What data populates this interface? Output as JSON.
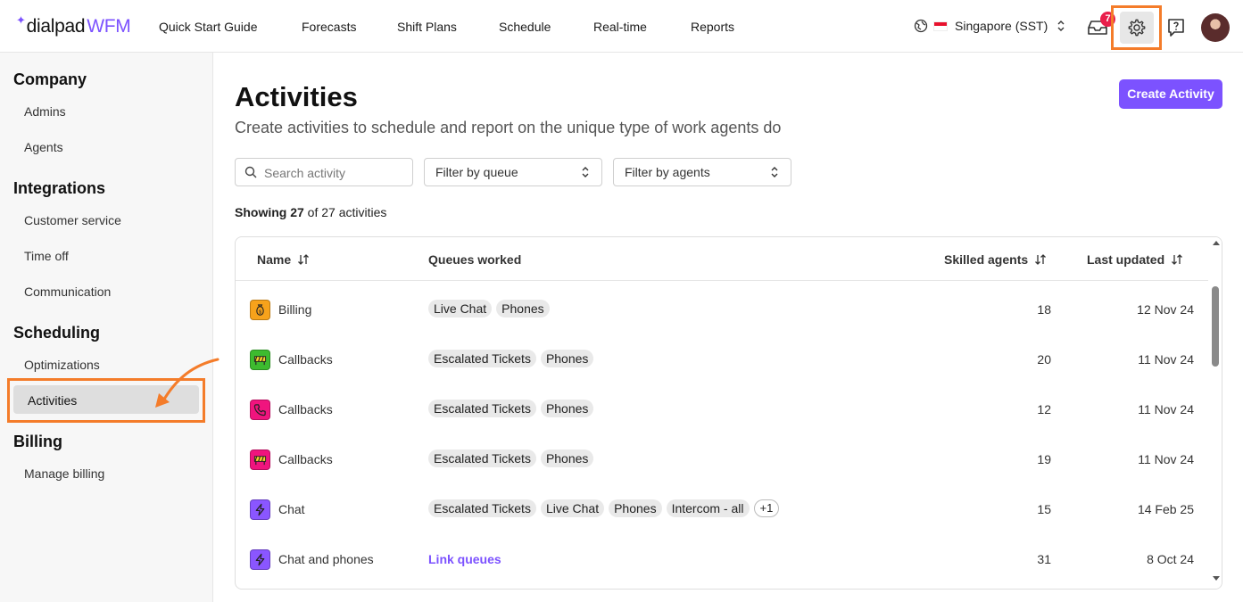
{
  "brand": {
    "part1": "dialpad",
    "part2": "WFM",
    "spark": "✦"
  },
  "nav": [
    "Quick Start Guide",
    "Forecasts",
    "Shift Plans",
    "Schedule",
    "Real-time",
    "Reports"
  ],
  "header": {
    "timezone": "Singapore (SST)",
    "inbox_badge": "7",
    "icons": [
      "globe-icon",
      "flag-icon",
      "inbox-icon",
      "gear-icon",
      "help-icon",
      "avatar"
    ]
  },
  "sidebar": {
    "sections": [
      {
        "title": "Company",
        "items": [
          "Admins",
          "Agents"
        ]
      },
      {
        "title": "Integrations",
        "items": [
          "Customer service",
          "Time off",
          "Communication"
        ]
      },
      {
        "title": "Scheduling",
        "items": [
          "Optimizations",
          "Activities"
        ]
      },
      {
        "title": "Billing",
        "items": [
          "Manage billing"
        ]
      }
    ],
    "active_item": "Activities"
  },
  "page": {
    "title": "Activities",
    "subtitle": "Create activities to schedule and report on the unique type of work agents do",
    "create_button": "Create Activity"
  },
  "filters": {
    "search_placeholder": "Search activity",
    "queue_filter": "Filter by queue",
    "agent_filter": "Filter by agents"
  },
  "summary": {
    "prefix": "Showing 27",
    "suffix": " of 27 activities"
  },
  "table": {
    "columns": [
      "Name",
      "Queues worked",
      "Skilled agents",
      "Last updated"
    ],
    "rows": [
      {
        "icon": "moneybag-icon",
        "icon_color": "#f7a21b",
        "name": "Billing",
        "queues": [
          "Live Chat",
          "Phones"
        ],
        "agents": "18",
        "updated": "12 Nov 24"
      },
      {
        "icon": "barrier-icon",
        "icon_color": "#3dbb2f",
        "name": "Callbacks",
        "queues": [
          "Escalated Tickets",
          "Phones"
        ],
        "agents": "20",
        "updated": "11 Nov 24"
      },
      {
        "icon": "phone-icon",
        "icon_color": "#f0147e",
        "name": "Callbacks",
        "queues": [
          "Escalated Tickets",
          "Phones"
        ],
        "agents": "12",
        "updated": "11 Nov 24"
      },
      {
        "icon": "barrier-icon",
        "icon_color": "#f0147e",
        "name": "Callbacks",
        "queues": [
          "Escalated Tickets",
          "Phones"
        ],
        "agents": "19",
        "updated": "11 Nov 24"
      },
      {
        "icon": "bolt-icon",
        "icon_color": "#8a56ff",
        "name": "Chat",
        "queues": [
          "Escalated Tickets",
          "Live Chat",
          "Phones",
          "Intercom - all"
        ],
        "more": "+1",
        "agents": "15",
        "updated": "14 Feb 25"
      },
      {
        "icon": "bolt-icon",
        "icon_color": "#8a56ff",
        "name": "Chat and phones",
        "queues": [],
        "link": "Link queues",
        "agents": "31",
        "updated": "8 Oct 24"
      }
    ]
  },
  "colors": {
    "accent": "#7c52ff",
    "highlight": "#f47c2a",
    "badge": "#e91e4b"
  }
}
